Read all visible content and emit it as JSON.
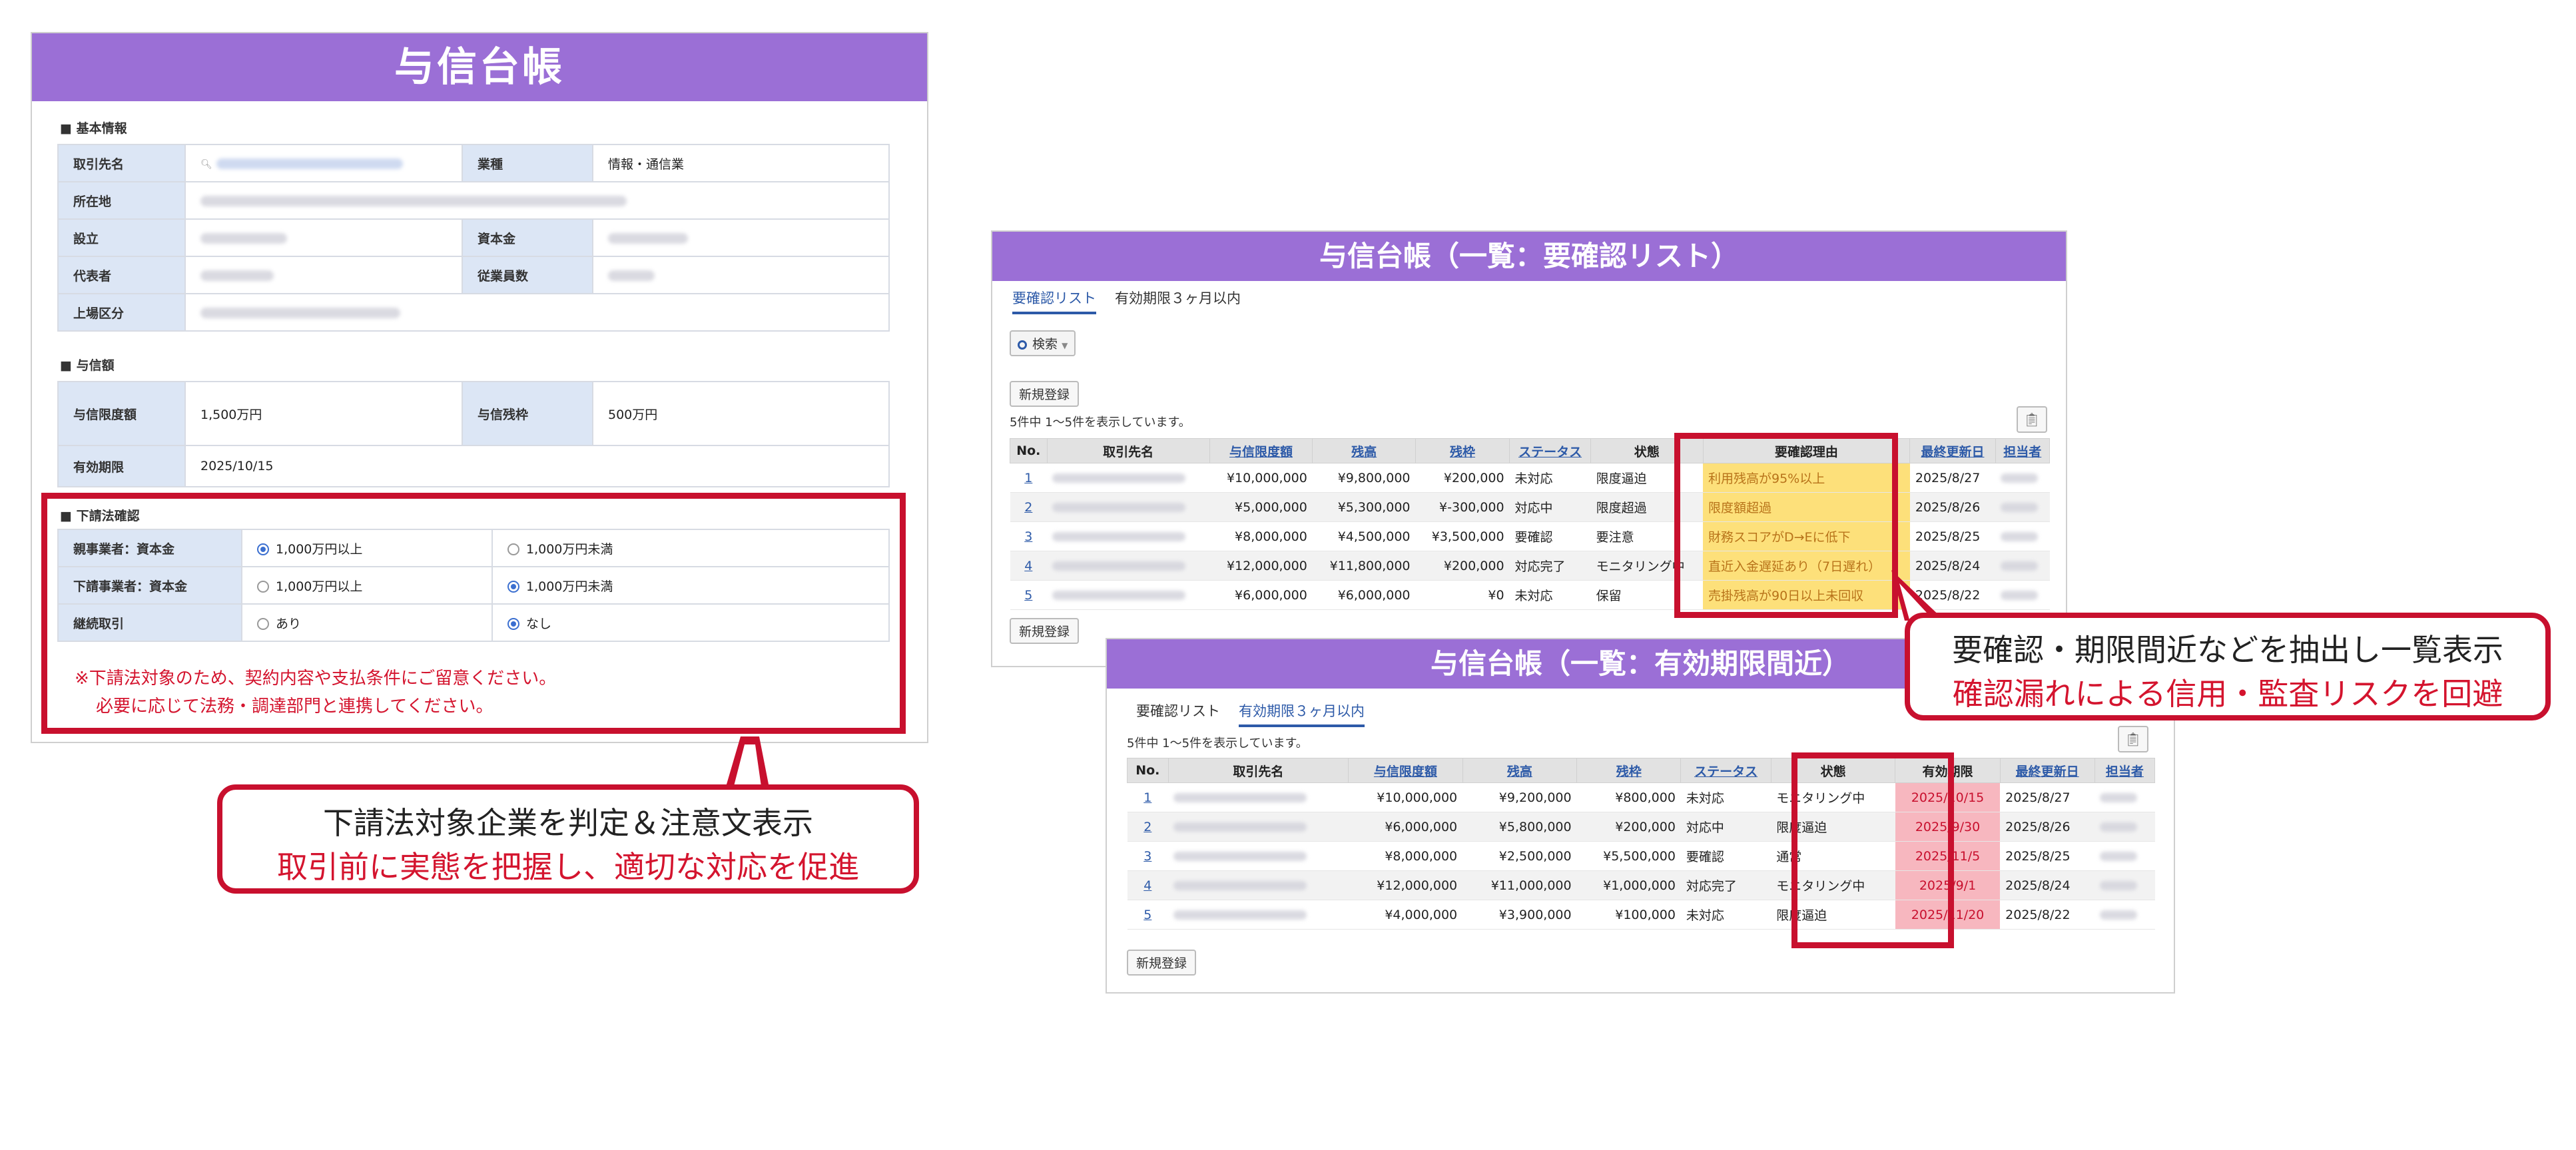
{
  "left_panel": {
    "title": "与信台帳",
    "basic": {
      "section": "■ 基本情報",
      "client_label": "取引先名",
      "industry_label": "業種",
      "industry_value": "情報・通信業",
      "address_label": "所在地",
      "established_label": "設立",
      "capital_label": "資本金",
      "representative_label": "代表者",
      "employees_label": "従業員数",
      "listing_label": "上場区分"
    },
    "credit": {
      "section": "■ 与信額",
      "limit_label": "与信限度額",
      "limit_value": "1,500万円",
      "balance_label": "与信残枠",
      "balance_value": "500万円",
      "expiry_label": "有効期限",
      "expiry_value": "2025/10/15"
    },
    "subcontract": {
      "section": "■ 下請法確認",
      "rows": [
        {
          "label": "親事業者：資本金",
          "opt1": "1,000万円以上",
          "opt2": "1,000万円未満"
        },
        {
          "label": "下請事業者：資本金",
          "opt1": "1,000万円以上",
          "opt2": "1,000万円未満"
        },
        {
          "label": "継続取引",
          "opt1": "あり",
          "opt2": "なし"
        }
      ],
      "notice_line1": "※下請法対象のため、契約内容や支払条件にご留意ください。",
      "notice_line2": "必要に応じて法務・調達部門と連携してください。"
    },
    "callout": {
      "line1": "下請法対象企業を判定＆注意文表示",
      "line2": "取引前に実態を把握し、適切な対応を促進"
    }
  },
  "list_panel_1": {
    "title": "与信台帳（一覧：要確認リスト）",
    "tabs": [
      "要確認リスト",
      "有効期限３ヶ月以内"
    ],
    "search_label": "検索",
    "new_button": "新規登録",
    "count_text": "5件中 1〜5件を表示しています。",
    "headers": [
      "No.",
      "取引先名",
      "与信限度額",
      "残高",
      "残枠",
      "ステータス",
      "状態",
      "要確認理由",
      "最終更新日",
      "担当者"
    ],
    "rows": [
      {
        "no": "1",
        "limit": "¥10,000,000",
        "balance": "¥9,800,000",
        "remain": "¥200,000",
        "status": "未対応",
        "state": "限度逼迫",
        "reason": "利用残高が95%以上",
        "updated": "2025/8/27"
      },
      {
        "no": "2",
        "limit": "¥5,000,000",
        "balance": "¥5,300,000",
        "remain": "¥-300,000",
        "status": "対応中",
        "state": "限度超過",
        "reason": "限度額超過",
        "updated": "2025/8/26"
      },
      {
        "no": "3",
        "limit": "¥8,000,000",
        "balance": "¥4,500,000",
        "remain": "¥3,500,000",
        "status": "要確認",
        "state": "要注意",
        "reason": "財務スコアがD→Eに低下",
        "updated": "2025/8/25"
      },
      {
        "no": "4",
        "limit": "¥12,000,000",
        "balance": "¥11,800,000",
        "remain": "¥200,000",
        "status": "対応完了",
        "state": "モニタリング中",
        "reason": "直近入金遅延あり（7日遅れ）",
        "updated": "2025/8/24"
      },
      {
        "no": "5",
        "limit": "¥6,000,000",
        "balance": "¥6,000,000",
        "remain": "¥0",
        "status": "未対応",
        "state": "保留",
        "reason": "売掛残高が90日以上未回収",
        "updated": "2025/8/22"
      }
    ],
    "callout": {
      "line1": "要確認・期限間近などを抽出し一覧表示",
      "line2": "確認漏れによる信用・監査リスクを回避"
    }
  },
  "list_panel_2": {
    "title": "与信台帳（一覧：有効期限間近）",
    "tabs": [
      "要確認リスト",
      "有効期限３ヶ月以内"
    ],
    "new_button": "新規登録",
    "count_text": "5件中 1〜5件を表示しています。",
    "headers": [
      "No.",
      "取引先名",
      "与信限度額",
      "残高",
      "残枠",
      "ステータス",
      "状態",
      "有効期限",
      "最終更新日",
      "担当者"
    ],
    "rows": [
      {
        "no": "1",
        "limit": "¥10,000,000",
        "balance": "¥9,200,000",
        "remain": "¥800,000",
        "status": "未対応",
        "state": "モニタリング中",
        "expiry": "2025/10/15",
        "updated": "2025/8/27"
      },
      {
        "no": "2",
        "limit": "¥6,000,000",
        "balance": "¥5,800,000",
        "remain": "¥200,000",
        "status": "対応中",
        "state": "限度逼迫",
        "expiry": "2025/9/30",
        "updated": "2025/8/26"
      },
      {
        "no": "3",
        "limit": "¥8,000,000",
        "balance": "¥2,500,000",
        "remain": "¥5,500,000",
        "status": "要確認",
        "state": "通常",
        "expiry": "2025/11/5",
        "updated": "2025/8/25"
      },
      {
        "no": "4",
        "limit": "¥12,000,000",
        "balance": "¥11,000,000",
        "remain": "¥1,000,000",
        "status": "対応完了",
        "state": "モニタリング中",
        "expiry": "2025/9/1",
        "updated": "2025/8/24"
      },
      {
        "no": "5",
        "limit": "¥4,000,000",
        "balance": "¥3,900,000",
        "remain": "¥100,000",
        "status": "未対応",
        "state": "限度逼迫",
        "expiry": "2025/11/20",
        "updated": "2025/8/22"
      }
    ]
  },
  "colors": {
    "title_bar": "#9b6fd6",
    "highlight_red": "#c8102e",
    "reason_yellow": "#fde07a",
    "expiry_pink": "#f7b7bf",
    "link_blue": "#2d5aa8"
  }
}
